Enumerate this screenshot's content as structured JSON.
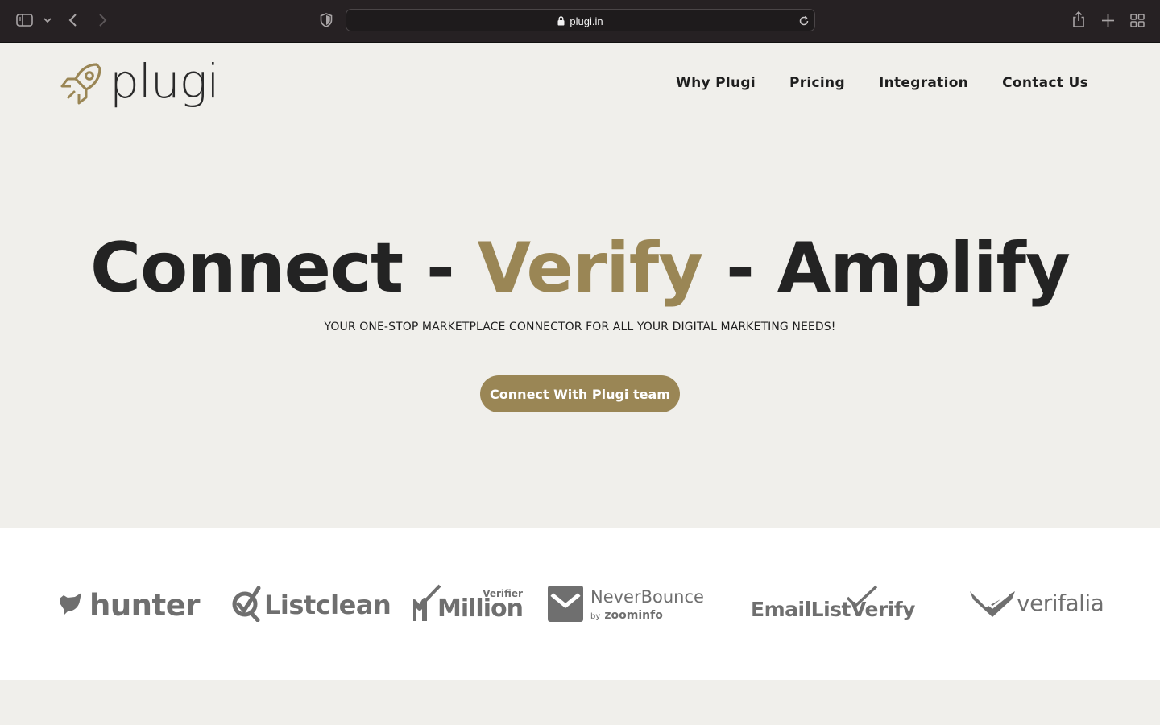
{
  "browser": {
    "url": "plugi.in",
    "icons": [
      "sidebar-icon",
      "chevron-down-icon",
      "back-icon",
      "forward-icon",
      "shield-icon",
      "lock-icon",
      "refresh-icon",
      "share-icon",
      "plus-icon",
      "tabs-grid-icon"
    ]
  },
  "header": {
    "logo_text": "plugi",
    "nav": [
      "Why Plugi",
      "Pricing",
      "Integration",
      "Contact Us"
    ]
  },
  "hero": {
    "title_part1": "Connect - ",
    "title_accent": "Verify",
    "title_part3": " - Amplify",
    "subtitle": "YOUR ONE-STOP MARKETPLACE CONNECTOR FOR ALL YOUR DIGITAL MARKETING NEEDS!",
    "cta_label": "Connect With Plugi team"
  },
  "partners": {
    "hunter": "hunter",
    "listclean": "Listclean",
    "million_small": "Verifier",
    "million_big": "Million",
    "neverbounce": "NeverBounce",
    "neverbounce_by": "by",
    "neverbounce_sub": "zoominfo",
    "emaillistverify": "EmailListVerify",
    "verifalia": "verifalia"
  },
  "colors": {
    "accent": "#9a8655",
    "page_bg": "#f0efeb",
    "text": "#232323",
    "chrome_bg": "#262123",
    "partner_gray": "#6f6f6f"
  }
}
